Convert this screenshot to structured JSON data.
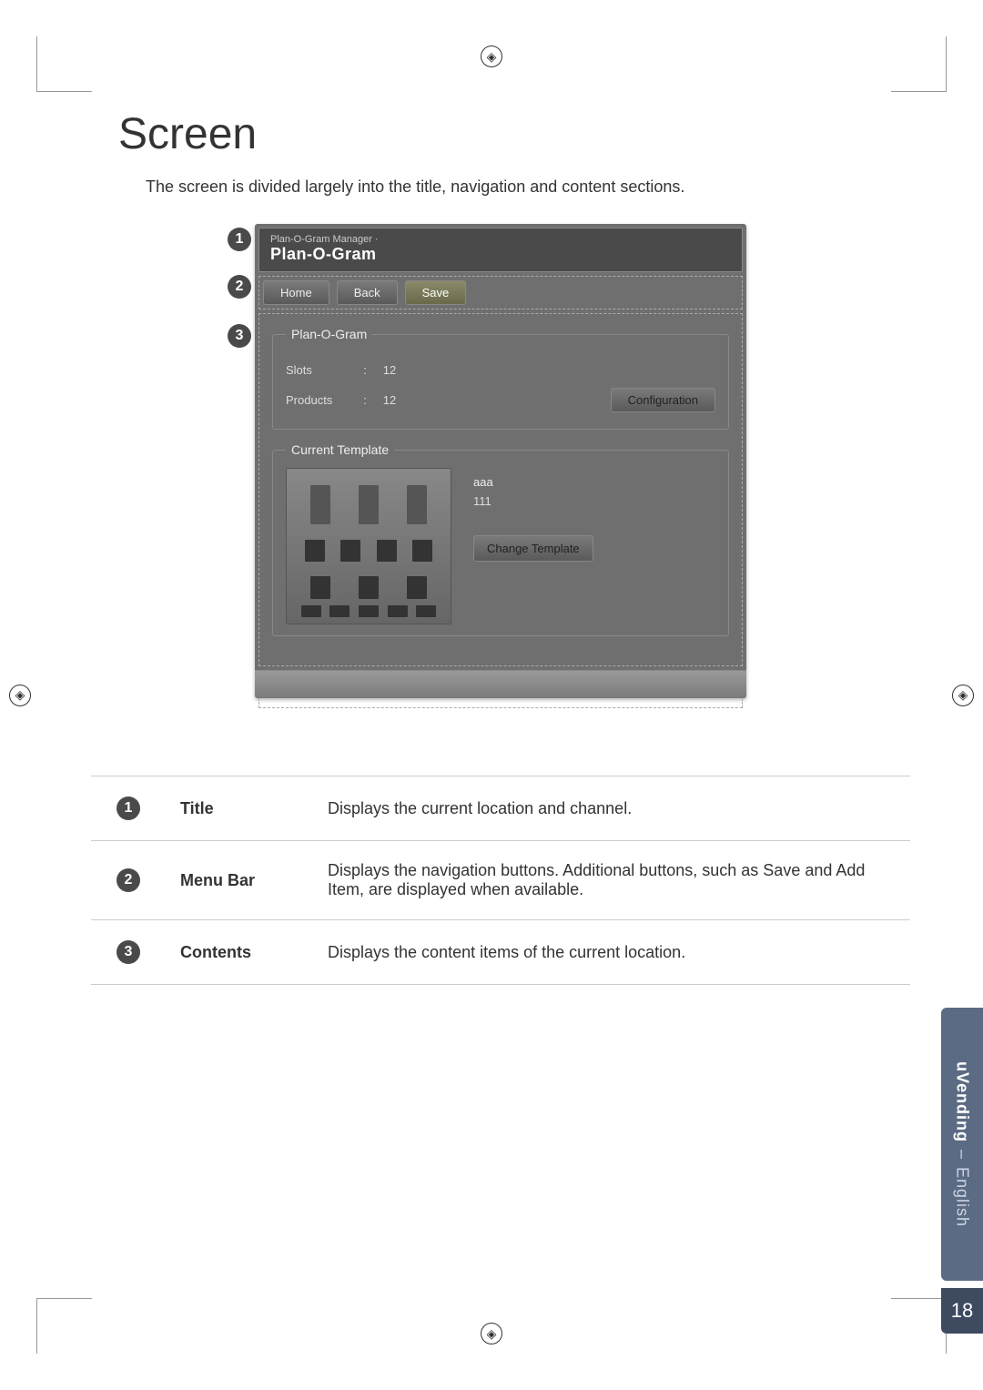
{
  "heading": "Screen",
  "intro": "The screen is divided largely into the title, navigation and content sections.",
  "callouts": {
    "one": "1",
    "two": "2",
    "three": "3"
  },
  "screenshot": {
    "title_small": "Plan-O-Gram Manager ·",
    "title_big": "Plan-O-Gram",
    "menu": {
      "home": "Home",
      "back": "Back",
      "save": "Save"
    },
    "group1_legend": "Plan-O-Gram",
    "slots_label": "Slots",
    "slots_value": "12",
    "products_label": "Products",
    "products_value": "12",
    "colon": ":",
    "config_btn": "Configuration",
    "group2_legend": "Current Template",
    "template_name": "aaa",
    "template_num": "111",
    "change_btn": "Change Template"
  },
  "table": {
    "r1_name": "Title",
    "r1_desc": "Displays the current location and channel.",
    "r2_name": "Menu Bar",
    "r2_desc": "Displays the navigation buttons. Additional buttons, such as Save and Add Item, are displayed when available.",
    "r3_name": "Contents",
    "r3_desc": "Displays the content items of the current location."
  },
  "side": {
    "bold": "uVending",
    "dash": "–",
    "light": "English"
  },
  "page_number": "18"
}
